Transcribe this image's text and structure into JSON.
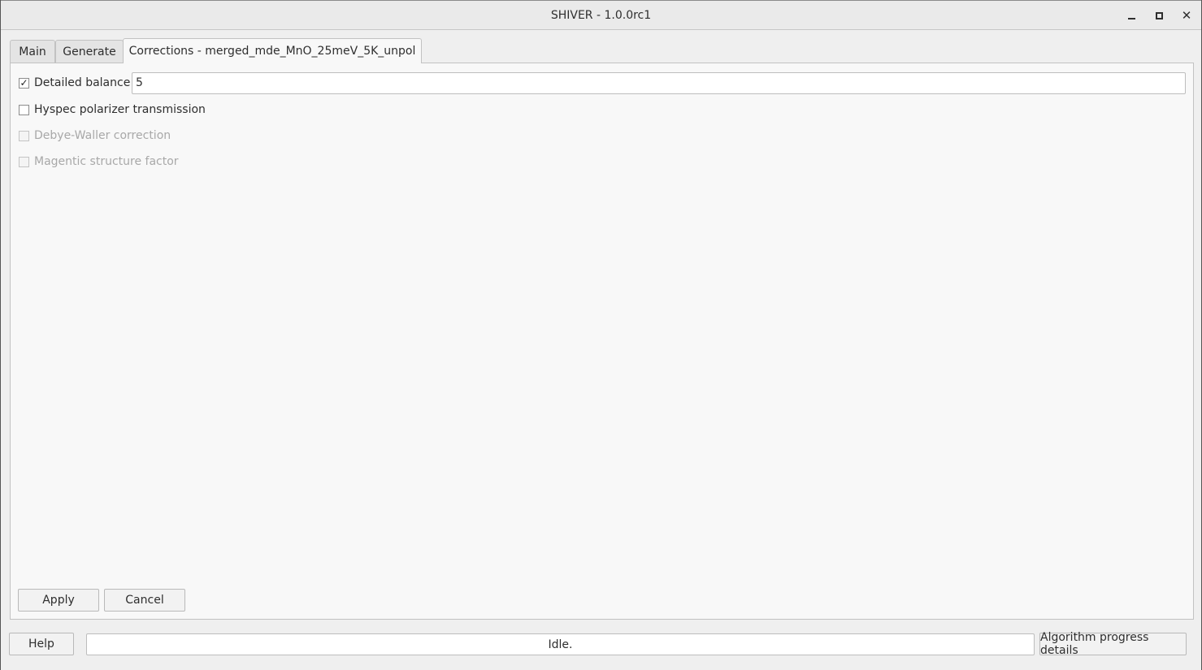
{
  "window": {
    "title": "SHIVER - 1.0.0rc1",
    "close_glyph": "✕"
  },
  "tabs": [
    {
      "label": "Main",
      "active": false
    },
    {
      "label": "Generate",
      "active": false
    },
    {
      "label": "Corrections - merged_mde_MnO_25meV_5K_unpol",
      "active": true
    }
  ],
  "corrections": {
    "detailed_balance": {
      "label": "Detailed balance",
      "checked": true,
      "check_glyph": "✓",
      "value": "5"
    },
    "hyspec_polarizer": {
      "label": "Hyspec polarizer transmission",
      "checked": false
    },
    "debye_waller": {
      "label": "Debye-Waller correction",
      "checked": false,
      "enabled": false
    },
    "magnetic_structure": {
      "label": "Magentic structure factor",
      "checked": false,
      "enabled": false
    }
  },
  "actions": {
    "apply_label": "Apply",
    "cancel_label": "Cancel"
  },
  "statusbar": {
    "help_label": "Help",
    "status_text": "Idle.",
    "progress_details_label": "Algorithm progress details"
  }
}
